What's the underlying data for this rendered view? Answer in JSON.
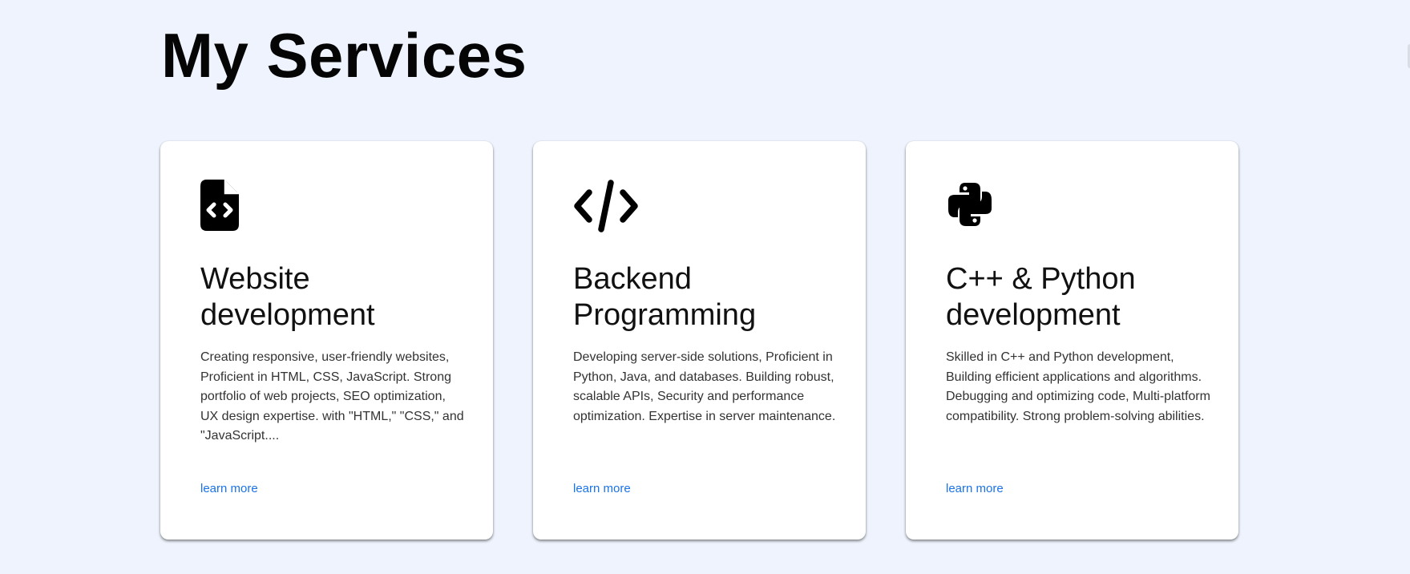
{
  "section": {
    "title": "My Services"
  },
  "services": [
    {
      "icon": "file-code-icon",
      "title": "Website development",
      "description": "Creating responsive, user-friendly websites, Proficient in HTML, CSS, JavaScript. Strong portfolio of web projects, SEO optimization, UX design expertise. with \"HTML,\" \"CSS,\" and \"JavaScript....",
      "link_label": "learn more"
    },
    {
      "icon": "code-icon",
      "title": "Backend Programming",
      "description": "Developing server-side solutions, Proficient in Python, Java, and databases. Building robust, scalable APIs, Security and performance optimization. Expertise in server maintenance.",
      "link_label": "learn more"
    },
    {
      "icon": "python-icon",
      "title": "C++ & Python development",
      "description": "Skilled in C++ and Python development, Building efficient applications and algorithms. Debugging and optimizing code, Multi-platform compatibility. Strong problem-solving abilities.",
      "link_label": "learn more"
    }
  ],
  "colors": {
    "background": "#eef3fd",
    "card": "#ffffff",
    "link": "#1a73e8",
    "text": "#111111"
  }
}
